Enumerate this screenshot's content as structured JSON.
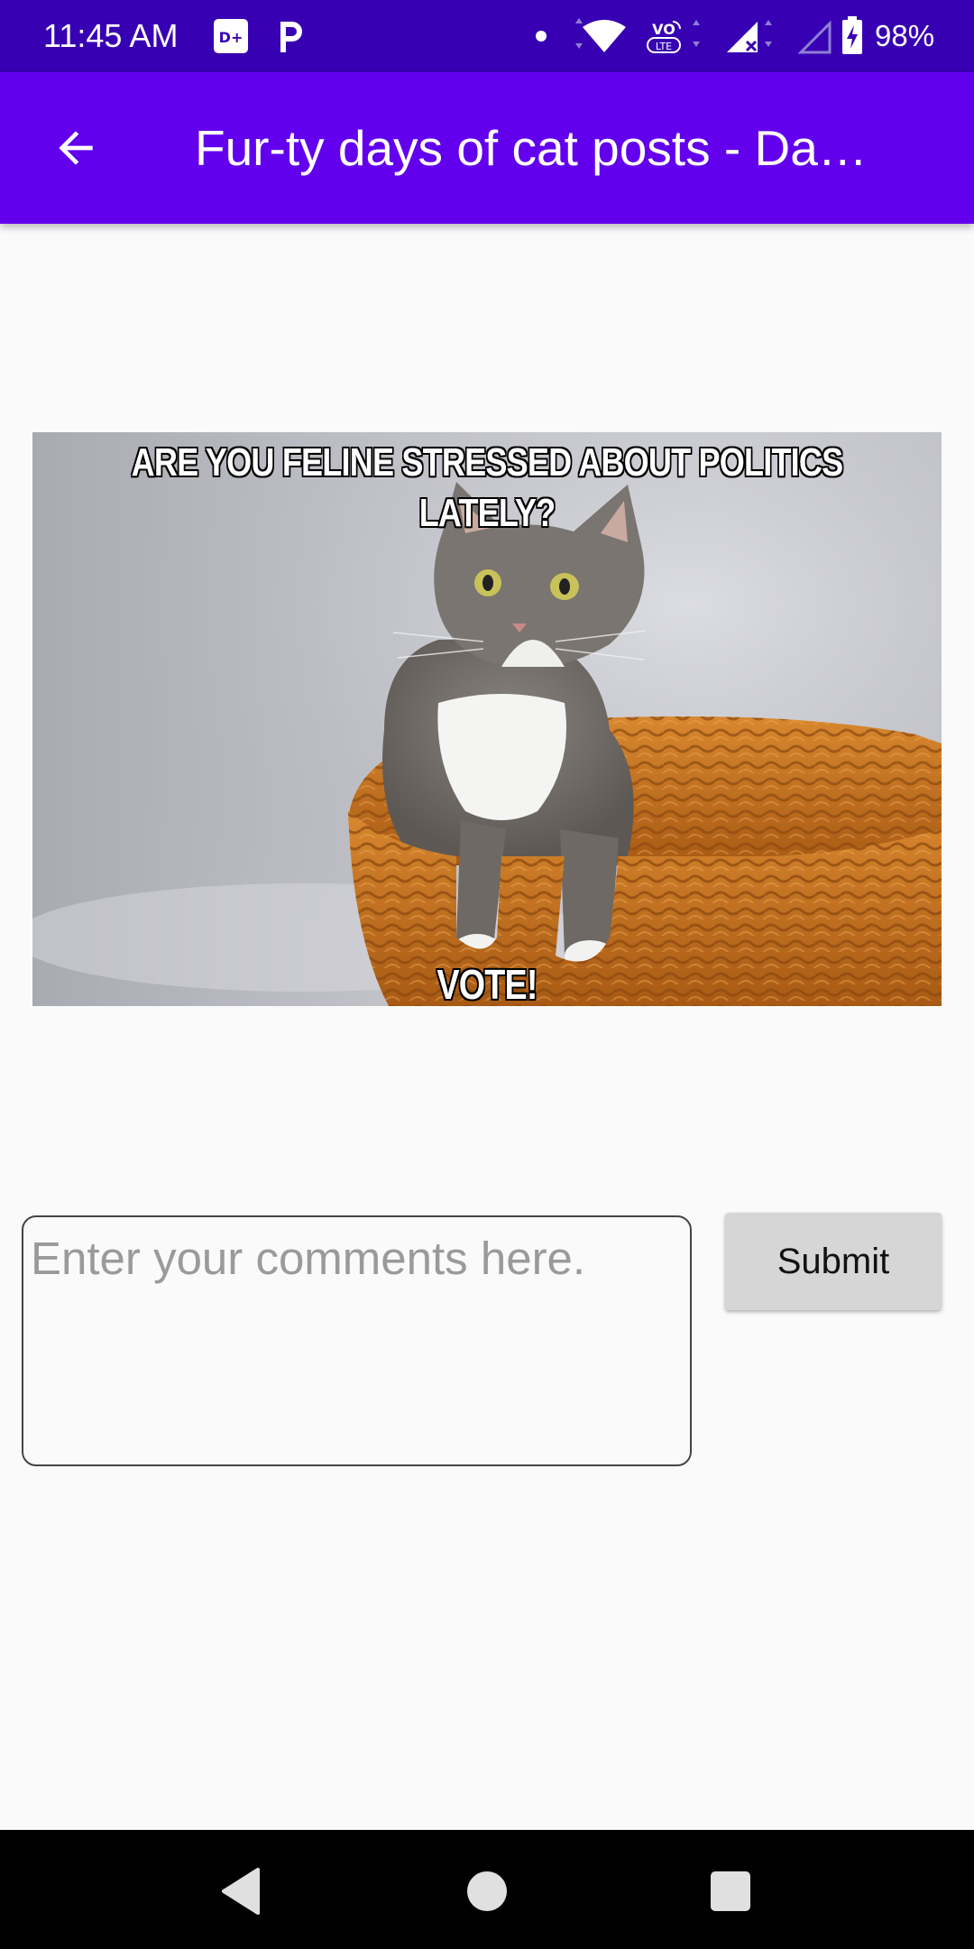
{
  "status_bar": {
    "time": "11:45 AM",
    "battery": "98%",
    "icons": [
      "disney-plus-icon",
      "p-app-icon",
      "notification-dot-icon",
      "wifi-icon",
      "volte-icon",
      "signal-icon",
      "signal-empty-icon",
      "battery-charging-icon"
    ],
    "background": "#3700b3"
  },
  "app_bar": {
    "title": "Fur-ty days of cat posts - Da…",
    "back_icon": "arrow-back-icon",
    "background": "#6200ee"
  },
  "post": {
    "meme_top_text": "ARE YOU FELINE STRESSED ABOUT POLITICS LATELY?",
    "meme_bottom_text": "VOTE!"
  },
  "comment": {
    "placeholder": "Enter your comments here.",
    "value": "",
    "submit_label": "Submit"
  },
  "nav_bar": {
    "icons": [
      "back-triangle-icon",
      "home-circle-icon",
      "recents-square-icon"
    ]
  }
}
